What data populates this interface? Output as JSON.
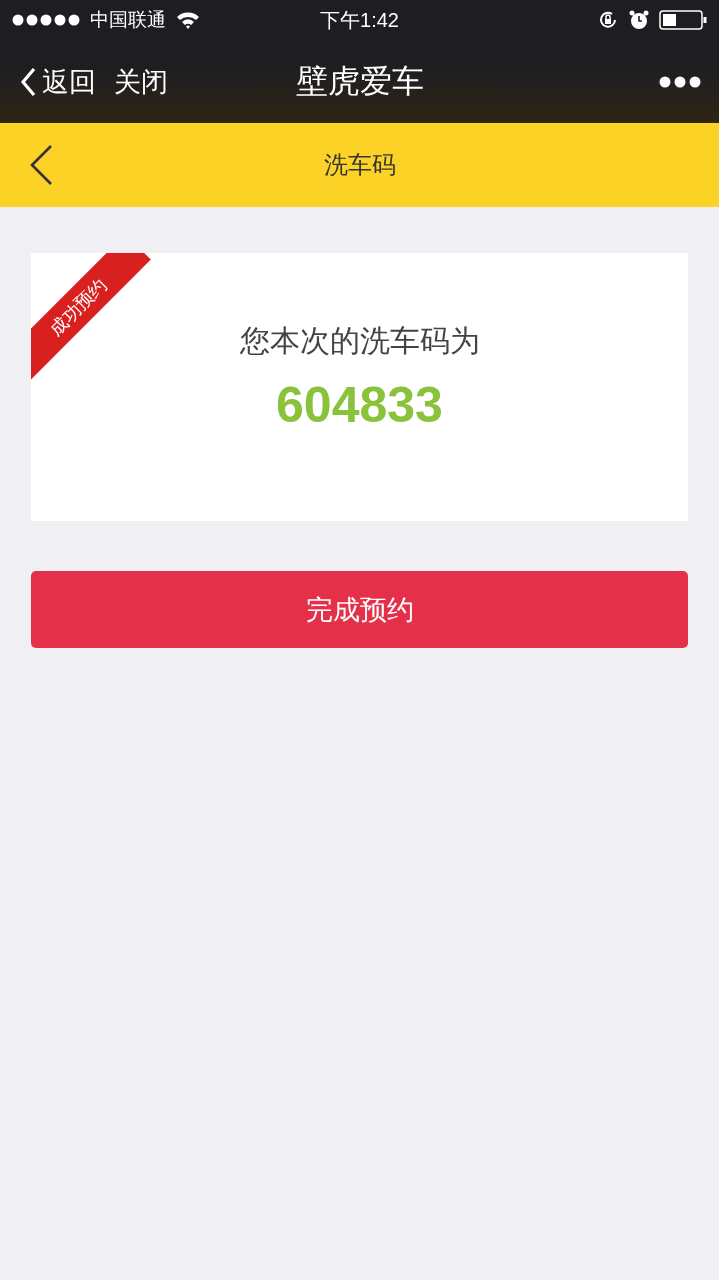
{
  "status_bar": {
    "carrier": "中国联通",
    "time": "下午1:42"
  },
  "wechat_bar": {
    "back": "返回",
    "close": "关闭",
    "title": "壁虎爱车"
  },
  "header": {
    "title": "洗车码"
  },
  "card": {
    "ribbon": "成功预约",
    "caption": "您本次的洗车码为",
    "code": "604833"
  },
  "button": {
    "label": "完成预约"
  }
}
